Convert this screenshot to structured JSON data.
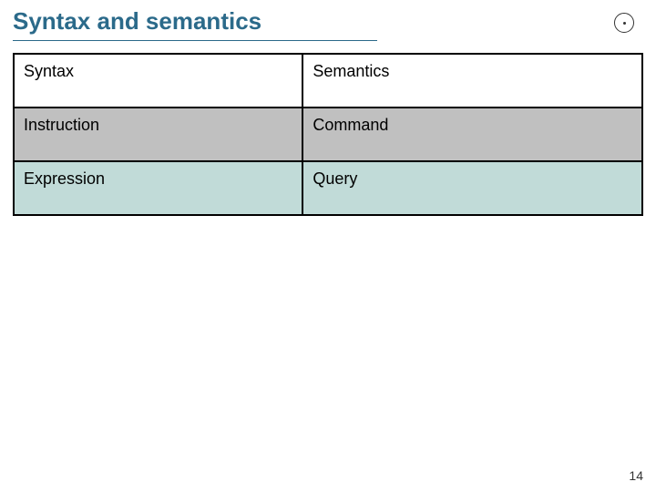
{
  "title": "Syntax and semantics",
  "page_number": "14",
  "chart_data": {
    "type": "table",
    "columns": [
      "Syntax",
      "Semantics"
    ],
    "rows": [
      {
        "syntax": "Syntax",
        "semantics": "Semantics",
        "shade": "white"
      },
      {
        "syntax": "Instruction",
        "semantics": "Command",
        "shade": "grey"
      },
      {
        "syntax": "Expression",
        "semantics": "Query",
        "shade": "teal"
      }
    ]
  }
}
